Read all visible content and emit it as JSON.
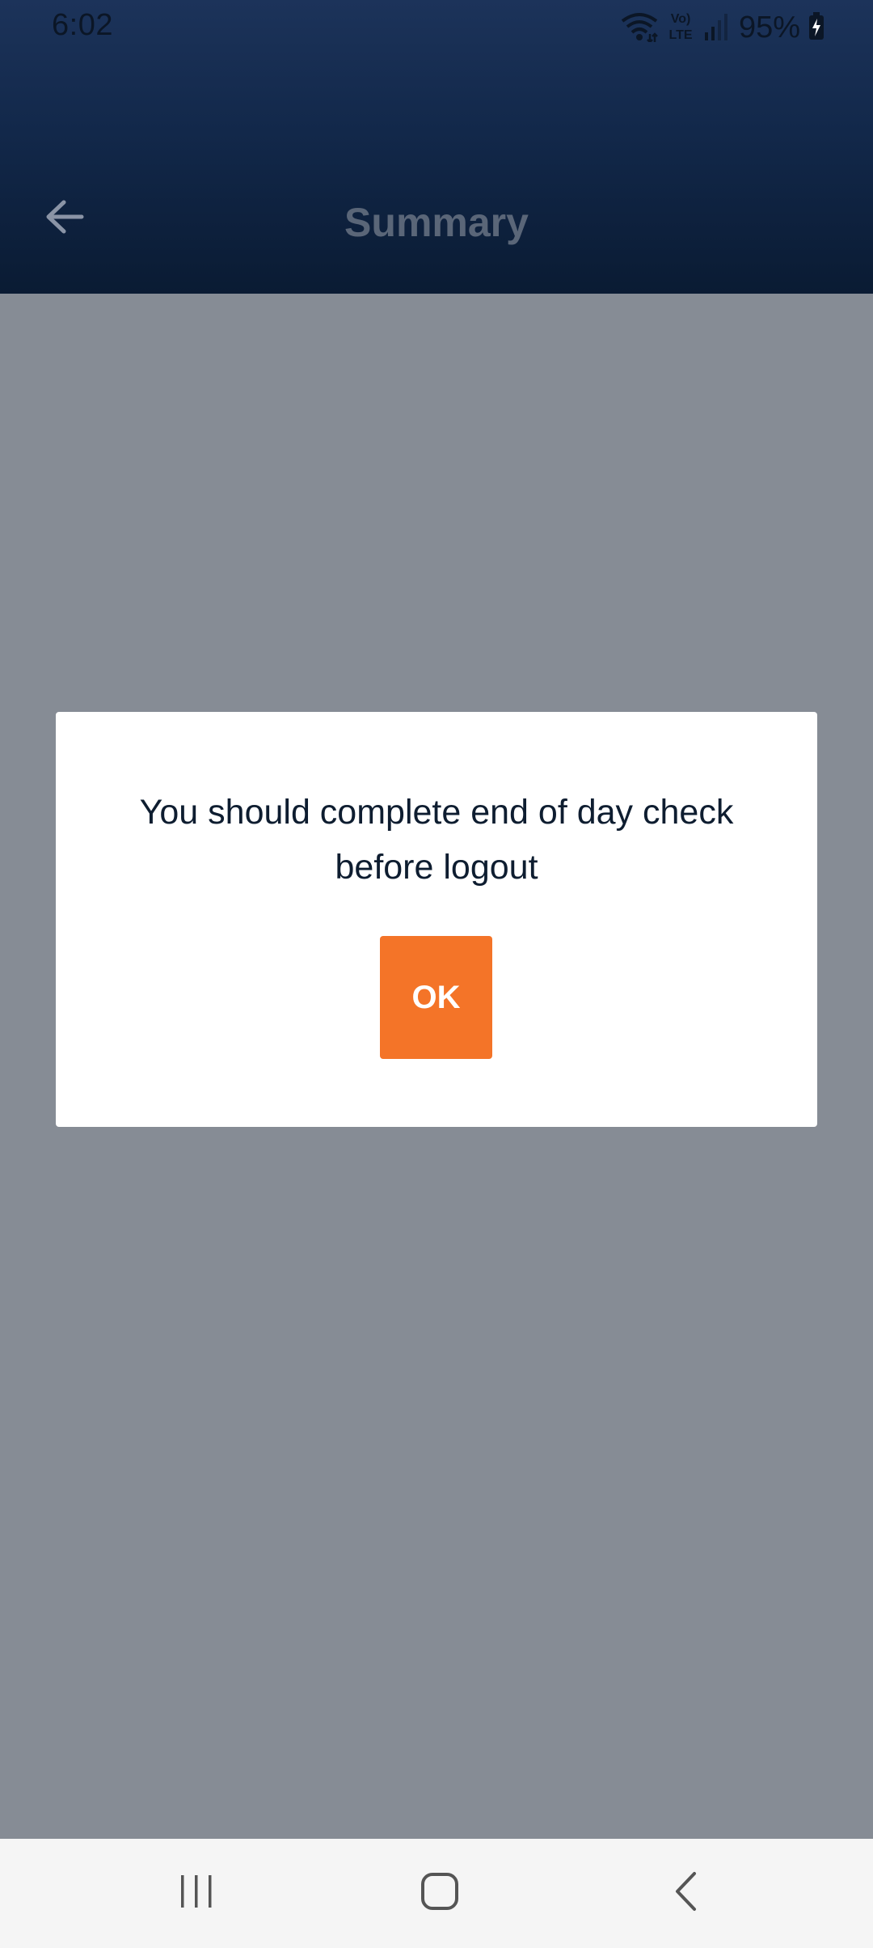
{
  "status_bar": {
    "time": "6:02",
    "battery": "95%",
    "icons": [
      "wifi-icon",
      "volte-icon",
      "signal-icon",
      "battery-charging-icon"
    ]
  },
  "header": {
    "title": "Summary",
    "back_icon": "arrow-left-icon"
  },
  "dialog": {
    "message": "You should complete end of day check before logout",
    "ok_label": "OK"
  },
  "nav_bar": {
    "items": [
      "recent-apps-icon",
      "home-icon",
      "back-icon"
    ]
  },
  "colors": {
    "header_top": "#1c335a",
    "header_bottom": "#0a1b33",
    "scrim": "#868c95",
    "accent": "#f47428",
    "dialog_text": "#0e1d30",
    "title_text": "#5a6678"
  }
}
